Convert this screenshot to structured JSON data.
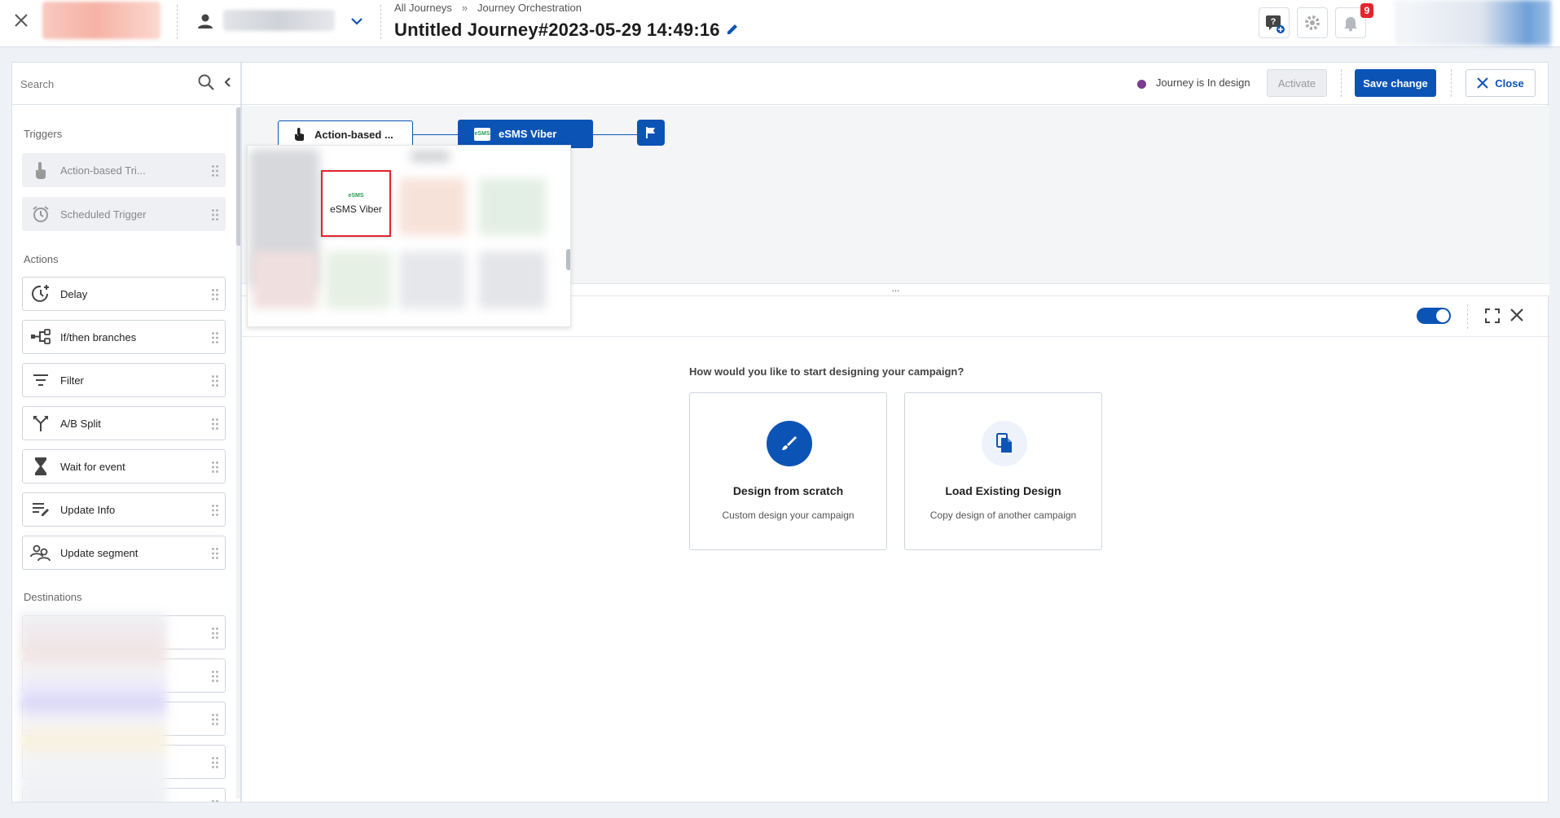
{
  "header": {
    "breadcrumb": [
      "All Journeys",
      "»",
      "Journey Orchestration"
    ],
    "title": "Untitled Journey#2023-05-29 14:49:16",
    "notification_count": "9"
  },
  "sidebar": {
    "search_placeholder": "Search",
    "triggers_label": "Triggers",
    "triggers": [
      {
        "label": "Action-based Tri...",
        "icon": "touch-icon"
      },
      {
        "label": "Scheduled Trigger",
        "icon": "alarm-clock-icon"
      }
    ],
    "actions_label": "Actions",
    "actions": [
      {
        "label": "Delay",
        "icon": "timer-plus-icon"
      },
      {
        "label": "If/then branches",
        "icon": "branch-icon"
      },
      {
        "label": "Filter",
        "icon": "filter-icon"
      },
      {
        "label": "A/B Split",
        "icon": "split-icon"
      },
      {
        "label": "Wait for event",
        "icon": "hourglass-icon"
      },
      {
        "label": "Update Info",
        "icon": "edit-list-icon"
      },
      {
        "label": "Update segment",
        "icon": "users-segment-icon"
      }
    ],
    "destinations_label": "Destinations"
  },
  "toolbar": {
    "status": "Journey is In design",
    "status_color": "#7b3b8e",
    "activate": "Activate",
    "save": "Save change",
    "close": "Close"
  },
  "canvas": {
    "trigger_node": "Action-based ...",
    "esms_node": "eSMS Viber",
    "popup_selected": "eSMS Viber",
    "logo_text": "eSMS"
  },
  "editor": {
    "splitter": "...",
    "question": "How would you like to start designing your campaign?",
    "options": [
      {
        "title": "Design from scratch",
        "subtitle": "Custom design your campaign"
      },
      {
        "title": "Load Existing Design",
        "subtitle": "Copy design of another campaign"
      }
    ]
  },
  "colors": {
    "primary": "#0b54b6",
    "badge": "#e5242b",
    "highlight": "#e0242e"
  }
}
